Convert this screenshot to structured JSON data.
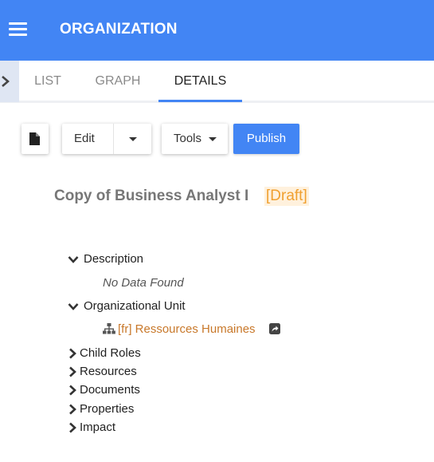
{
  "app": {
    "title": "ORGANIZATION"
  },
  "tabs": [
    {
      "label": "LIST"
    },
    {
      "label": "GRAPH"
    },
    {
      "label": "DETAILS"
    }
  ],
  "toolbar": {
    "edit_label": "Edit",
    "tools_label": "Tools",
    "publish_label": "Publish"
  },
  "record": {
    "title": "Copy of Business Analyst I",
    "status": "[Draft]"
  },
  "sections": {
    "description": {
      "label": "Description",
      "empty_text": "No Data Found"
    },
    "org_unit": {
      "label": "Organizational Unit",
      "link_text": "[fr] Ressources Humaines"
    },
    "child_roles": {
      "label": "Child Roles"
    },
    "resources": {
      "label": "Resources"
    },
    "documents": {
      "label": "Documents"
    },
    "properties": {
      "label": "Properties"
    },
    "impact": {
      "label": "Impact"
    }
  },
  "colors": {
    "header": "#4285f4",
    "publish": "#4285f4",
    "draft": "#f0a030",
    "link": "#c8782a"
  }
}
